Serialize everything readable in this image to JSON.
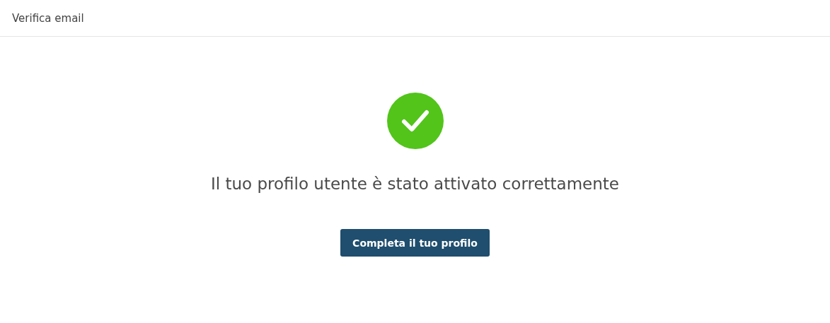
{
  "header": {
    "title": "Verifica email"
  },
  "message": "Il tuo profilo utente è stato attivato correttamente",
  "button": {
    "label": "Completa il tuo profilo"
  }
}
